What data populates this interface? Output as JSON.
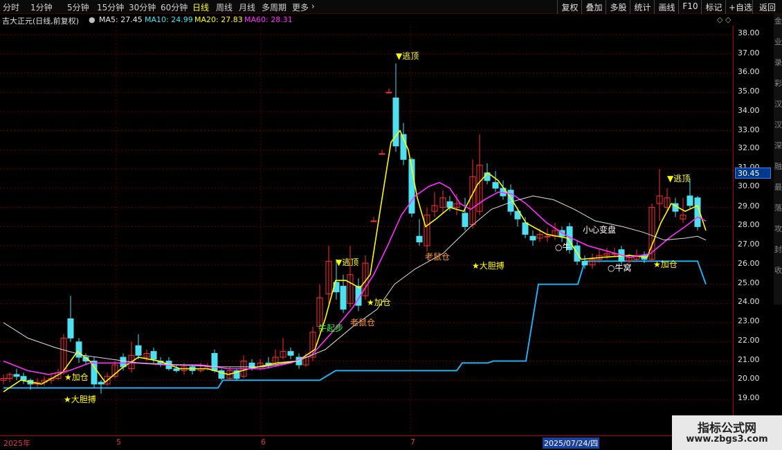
{
  "toolbar": {
    "periods": [
      "分时",
      "1分钟",
      "5分钟",
      "15分钟",
      "30分钟",
      "60分钟",
      "日线",
      "周线",
      "月线",
      "多周期",
      "更多"
    ],
    "active_period": "日线",
    "more_arrow": "›",
    "right_buttons": [
      "复权",
      "叠加",
      "多股",
      "统计",
      "画线",
      "F10",
      "标记",
      "+自选",
      "返回"
    ]
  },
  "info": {
    "stock_title": "吉大正元(日线,前复权)",
    "ma5": "MA5: 27.45",
    "ma10": "MA10: 24.99",
    "ma20": "MA20: 27.83",
    "ma60": "MA60: 28.31",
    "icons": "◇ ◇"
  },
  "price_axis": [
    "38.00",
    "37.00",
    "36.00",
    "35.00",
    "34.00",
    "33.00",
    "32.00",
    "31.00",
    "30.00",
    "29.00",
    "28.00",
    "27.00",
    "26.00",
    "25.00",
    "24.00",
    "23.00",
    "22.00",
    "21.00",
    "20.00",
    "19.00"
  ],
  "current_price": "30.45",
  "side_text": [
    "金",
    "业",
    "录",
    "彩",
    "汉",
    "汉",
    "深",
    "融",
    "最",
    "落",
    "攻",
    "封",
    "收"
  ],
  "date_axis": {
    "labels": [
      "2025年",
      "5",
      "6",
      "7"
    ],
    "cursor": "2025/07/24/四"
  },
  "signals": {
    "escape_top_1": "▼逃顶",
    "escape_top_2": "▼逃顶",
    "escape_top_3": "▼逃顶",
    "add_pos_1": "★加仓",
    "add_pos_2": "★加仓",
    "add_pos_3": "★加仓",
    "bold_1": "★大胆搏",
    "bold_2": "★大胆搏",
    "bull_start": "牛起步",
    "rat_1": "老鼠仓",
    "rat_2": "老鼠仓",
    "bull_1": "○牛",
    "bull_nest": "○牛窝",
    "careful": "小心变盘"
  },
  "watermark": {
    "title": "指标公式网",
    "url": "www.zbgs3.com"
  },
  "colors": {
    "up": "#ff3030",
    "down": "#4ee0f0",
    "ma5": "#ffff00",
    "ma10": "#ff30ff",
    "ma20": "#e0e0e0",
    "stop": "#20b0f0",
    "grid": "#600000"
  }
}
